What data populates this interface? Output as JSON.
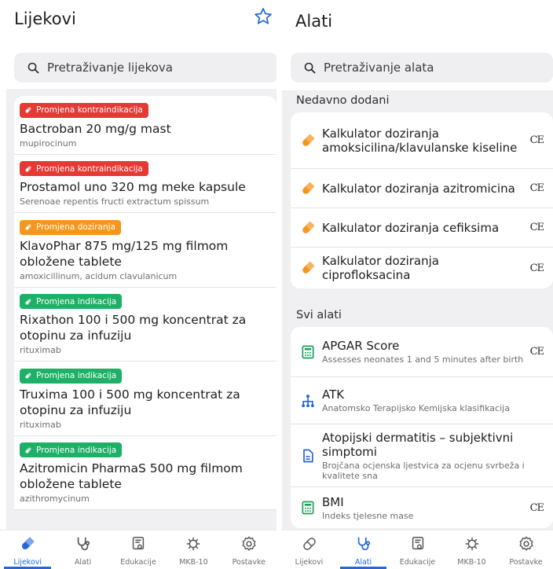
{
  "left": {
    "title": "Lijekovi",
    "search_placeholder": "Pretraživanje lijekova",
    "drugs": [
      {
        "badge": "Promjena kontraindikacija",
        "badge_color": "#e53935",
        "name": "Bactroban 20 mg/g mast",
        "sub": "mupirocinum"
      },
      {
        "badge": "Promjena kontraindikacija",
        "badge_color": "#e53935",
        "name": "Prostamol uno 320 mg meke kapsule",
        "sub": "Serenoae repentis fructi extractum spissum"
      },
      {
        "badge": "Promjena doziranja",
        "badge_color": "#f5961e",
        "name": "KlavoPhar 875 mg/125 mg filmom obložene tablete",
        "sub": "amoxicillinum, acidum clavulanicum"
      },
      {
        "badge": "Promjena indikacija",
        "badge_color": "#1eb066",
        "name": "Rixathon 100 i 500 mg koncentrat za otopinu za infuziju",
        "sub": "rituximab"
      },
      {
        "badge": "Promjena indikacija",
        "badge_color": "#1eb066",
        "name": "Truxima 100 i 500 mg koncentrat za otopinu za infuziju",
        "sub": "rituximab"
      },
      {
        "badge": "Promjena indikacija",
        "badge_color": "#1eb066",
        "name": "Azitromicin PharmaS 500 mg filmom obložene tablete",
        "sub": "azithromycinum"
      }
    ]
  },
  "right": {
    "title": "Alati",
    "search_placeholder": "Pretraživanje alata",
    "recent_label": "Nedavno dodani",
    "recent": [
      {
        "title": "Kalkulator doziranja amoksicilina/klavulanske kiseline",
        "ce": "CE"
      },
      {
        "title": "Kalkulator doziranja azitromicina",
        "ce": "CE"
      },
      {
        "title": "Kalkulator doziranja cefiksima",
        "ce": "CE"
      },
      {
        "title": "Kalkulator doziranja ciprofloksacina",
        "ce": "CE"
      }
    ],
    "all_label": "Svi alati",
    "all": [
      {
        "title": "APGAR Score",
        "desc": "Assesses neonates 1 and 5 minutes after birth",
        "ce": "CE",
        "icon": "calculator-icon"
      },
      {
        "title": "ATK",
        "desc": "Anatomsko Terapijsko Kemijska klasifikacija",
        "ce": "",
        "icon": "hierarchy-icon"
      },
      {
        "title": "Atopijski dermatitis – subjektivni simptomi",
        "desc": "Brojčana ocjenska ljestvica za ocjenu svrbeža i kvalitete sna",
        "ce": "",
        "icon": "document-icon"
      },
      {
        "title": "BMI",
        "desc": "Indeks tjelesne mase",
        "ce": "CE",
        "icon": "calculator-icon"
      }
    ]
  },
  "tabs": [
    {
      "label": "Lijekovi",
      "icon": "pill-tab-icon"
    },
    {
      "label": "Alati",
      "icon": "stethoscope-tab-icon"
    },
    {
      "label": "Edukacije",
      "icon": "certificate-tab-icon"
    },
    {
      "label": "MKB-10",
      "icon": "virus-tab-icon"
    },
    {
      "label": "Postavke",
      "icon": "settings-tab-icon"
    }
  ],
  "colors": {
    "accent": "#2566d8",
    "orange": "#f5961e",
    "green": "#1eb066",
    "red": "#e53935"
  }
}
